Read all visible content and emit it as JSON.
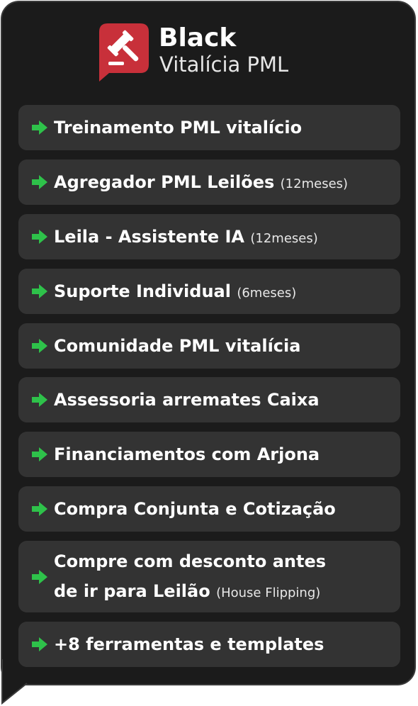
{
  "brand": {
    "title": "Black",
    "subtitle": "Vitalícia PML",
    "logo_icon": "gavel-icon",
    "logo_color": "#c8303a"
  },
  "colors": {
    "card_background": "#1b1b1b",
    "item_background": "#333333",
    "arrow": "#2ec24a",
    "text": "#ffffff"
  },
  "features": [
    {
      "text": "Treinamento PML vitalício",
      "note": ""
    },
    {
      "text": "Agregador PML Leilões",
      "note": "(12meses)"
    },
    {
      "text": "Leila - Assistente IA",
      "note": "(12meses)"
    },
    {
      "text": "Suporte Individual",
      "note": "(6meses)"
    },
    {
      "text": "Comunidade PML vitalícia",
      "note": ""
    },
    {
      "text": "Assessoria arremates Caixa",
      "note": ""
    },
    {
      "text": "Financiamentos com Arjona",
      "note": ""
    },
    {
      "text": "Compra Conjunta e Cotização",
      "note": ""
    },
    {
      "text": "Compre com desconto antes",
      "text_line2": "de ir para Leilão",
      "note": "(House Flipping)"
    },
    {
      "text": "+8 ferramentas e templates",
      "note": ""
    }
  ]
}
